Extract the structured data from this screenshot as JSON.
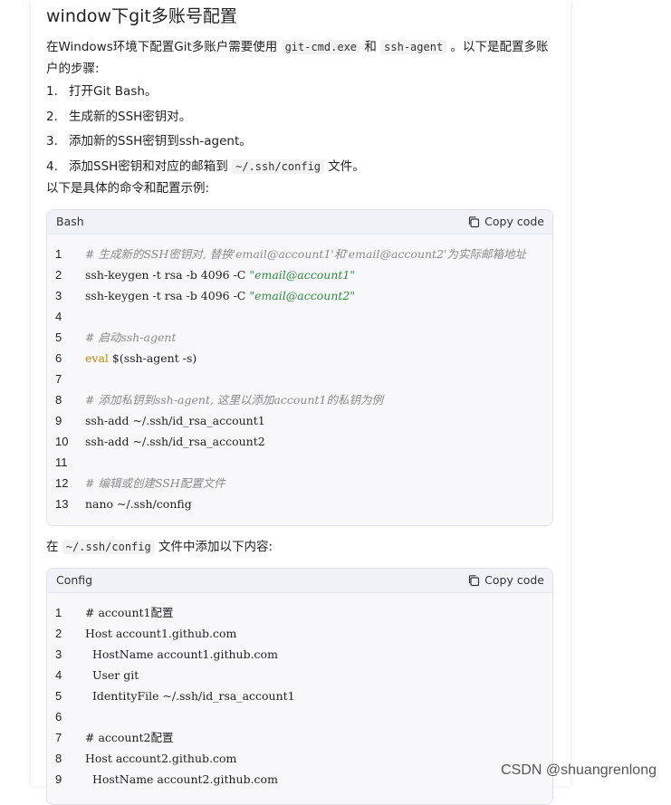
{
  "title": "window下git多账号配置",
  "intro": {
    "part1": "在Windows环境下配置Git多账户需要使用 ",
    "code1": "git-cmd.exe",
    "part2": " 和 ",
    "code2": "ssh-agent",
    "part3": " 。以下是配置多账",
    "line2": "户的步骤:"
  },
  "steps": [
    {
      "num": "1.",
      "text": "打开Git Bash。"
    },
    {
      "num": "2.",
      "text": "生成新的SSH密钥对。"
    },
    {
      "num": "3.",
      "text": "添加新的SSH密钥到ssh-agent。"
    },
    {
      "num": "4.",
      "text_before": "添加SSH密钥和对应的邮箱到 ",
      "code": "~/.ssh/config",
      "text_after": " 文件。"
    }
  ],
  "examples_intro": "以下是具体的命令和配置示例:",
  "bash_block": {
    "lang": "Bash",
    "copy_label": "Copy code",
    "lines": [
      {
        "n": "1",
        "segments": [
          {
            "t": "# 生成新的SSH密钥对, 替换'email@account1'和'email@account2'为实际邮箱地址",
            "c": "comment"
          }
        ]
      },
      {
        "n": "2",
        "segments": [
          {
            "t": "ssh-keygen -t rsa -b 4096 -C ",
            "c": ""
          },
          {
            "t": "\"email@account1\"",
            "c": "string"
          }
        ]
      },
      {
        "n": "3",
        "segments": [
          {
            "t": "ssh-keygen -t rsa -b 4096 -C ",
            "c": ""
          },
          {
            "t": "\"email@account2\"",
            "c": "string"
          }
        ]
      },
      {
        "n": "4",
        "segments": []
      },
      {
        "n": "5",
        "segments": [
          {
            "t": "# 启动ssh-agent",
            "c": "comment"
          }
        ]
      },
      {
        "n": "6",
        "segments": [
          {
            "t": "eval",
            "c": "keyword"
          },
          {
            "t": " $(ssh-agent -s)",
            "c": ""
          }
        ]
      },
      {
        "n": "7",
        "segments": []
      },
      {
        "n": "8",
        "segments": [
          {
            "t": "# 添加私钥到ssh-agent, 这里以添加account1的私钥为例",
            "c": "comment"
          }
        ]
      },
      {
        "n": "9",
        "segments": [
          {
            "t": "ssh-add ~/.ssh/id_rsa_account1",
            "c": ""
          }
        ]
      },
      {
        "n": "10",
        "segments": [
          {
            "t": "ssh-add ~/.ssh/id_rsa_account2",
            "c": ""
          }
        ]
      },
      {
        "n": "11",
        "segments": []
      },
      {
        "n": "12",
        "segments": [
          {
            "t": "# 编辑或创建SSH配置文件",
            "c": "comment"
          }
        ]
      },
      {
        "n": "13",
        "segments": [
          {
            "t": "nano ~/.ssh/config",
            "c": ""
          }
        ]
      }
    ]
  },
  "config_intro": {
    "before": "在 ",
    "code": "~/.ssh/config",
    "after": " 文件中添加以下内容:"
  },
  "config_block": {
    "lang": "Config",
    "copy_label": "Copy code",
    "lines": [
      {
        "n": "1",
        "segments": [
          {
            "t": "# account1配置",
            "c": ""
          }
        ]
      },
      {
        "n": "2",
        "segments": [
          {
            "t": "Host account1.github.com",
            "c": ""
          }
        ]
      },
      {
        "n": "3",
        "segments": [
          {
            "t": "  HostName account1.github.com",
            "c": ""
          }
        ]
      },
      {
        "n": "4",
        "segments": [
          {
            "t": "  User git",
            "c": ""
          }
        ]
      },
      {
        "n": "5",
        "segments": [
          {
            "t": "  IdentityFile ~/.ssh/id_rsa_account1",
            "c": ""
          }
        ]
      },
      {
        "n": "6",
        "segments": []
      },
      {
        "n": "7",
        "segments": [
          {
            "t": "# account2配置",
            "c": ""
          }
        ]
      },
      {
        "n": "8",
        "segments": [
          {
            "t": "Host account2.github.com",
            "c": ""
          }
        ]
      },
      {
        "n": "9",
        "segments": [
          {
            "t": "  HostName account2.github.com",
            "c": ""
          }
        ]
      }
    ]
  },
  "watermark": "CSDN @shuangrenlong",
  "colors": {
    "comment": "#8a8a8a",
    "string": "#2e8b3d",
    "keyword": "#b58b00"
  }
}
